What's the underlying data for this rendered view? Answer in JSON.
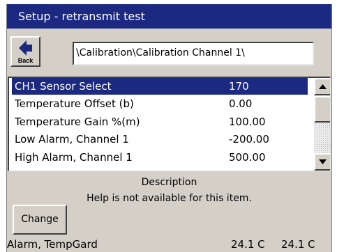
{
  "window": {
    "title": "Setup - retransmit test"
  },
  "toolbar": {
    "back_label": "Back",
    "back_icon": "left-arrow-icon",
    "path": "\\Calibration\\Calibration Channel 1\\"
  },
  "list": {
    "rows": [
      {
        "name": "CH1 Sensor Select",
        "value": "170",
        "selected": true
      },
      {
        "name": "Temperature Offset (b)",
        "value": "0.00",
        "selected": false
      },
      {
        "name": "Temperature Gain %(m)",
        "value": "100.00",
        "selected": false
      },
      {
        "name": "Low Alarm, Channel 1",
        "value": "-200.00",
        "selected": false
      },
      {
        "name": "High Alarm, Channel 1",
        "value": "500.00",
        "selected": false
      }
    ],
    "scroll_up_icon": "triangle-up-icon",
    "scroll_down_icon": "triangle-down-icon"
  },
  "description": {
    "title": "Description",
    "text": "Help is not available for this item."
  },
  "actions": {
    "change_label": "Change"
  },
  "status": {
    "left": "Alarm, TempGard",
    "temp1": "24.1 C",
    "temp2": "24.1 C"
  },
  "colors": {
    "title_bg": "#1c2980",
    "selection_bg": "#1c2980",
    "panel_bg": "#d4d0c8"
  }
}
